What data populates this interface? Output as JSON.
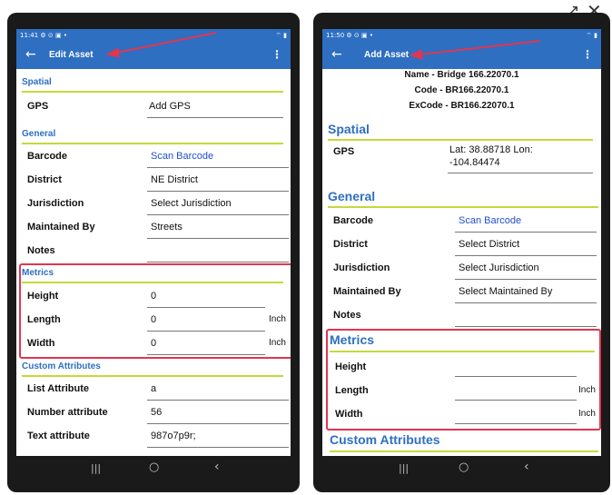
{
  "top_icons": {
    "external": "↗",
    "close": "✕"
  },
  "left": {
    "status_time": "11:41 ⚙ ⊙ ▣ •",
    "status_right": "⌔ ▮",
    "title": "Edit Asset",
    "back": "←",
    "menu": "⋮",
    "spatial_title": "Spatial",
    "gps_label": "GPS",
    "gps_value": "Add GPS",
    "general_title": "General",
    "barcode_label": "Barcode",
    "barcode_value": "Scan Barcode",
    "district_label": "District",
    "district_value": "NE District",
    "jurisdiction_label": "Jurisdiction",
    "jurisdiction_value": "Select Jurisdiction",
    "maintained_label": "Maintained By",
    "maintained_value": "Streets",
    "notes_label": "Notes",
    "notes_value": "",
    "metrics_title": "Metrics",
    "height_label": "Height",
    "height_value": "0",
    "length_label": "Length",
    "length_value": "0",
    "length_unit": "Inch",
    "width_label": "Width",
    "width_value": "0",
    "width_unit": "Inch",
    "custom_title": "Custom Attributes",
    "list_label": "List Attribute",
    "list_value": "a",
    "number_label": "Number attribute",
    "number_value": "56",
    "text_label": "Text attribute",
    "text_value": "987o7p9r;"
  },
  "right": {
    "status_time": "11:50 ⚙ ⊙ ▣ •",
    "status_right": "⌔ ▮",
    "title": "Add Asset",
    "back": "←",
    "menu": "⋮",
    "name_line": "Name - Bridge 166.22070.1",
    "code_line": "Code - BR166.22070.1",
    "excode_line": "ExCode - BR166.22070.1",
    "spatial_title": "Spatial",
    "gps_label": "GPS",
    "gps_value_line1": "Lat: 38.88718  Lon:",
    "gps_value_line2": "-104.84474",
    "general_title": "General",
    "barcode_label": "Barcode",
    "barcode_value": "Scan Barcode",
    "district_label": "District",
    "district_value": "Select District",
    "jurisdiction_label": "Jurisdiction",
    "jurisdiction_value": "Select Jurisdiction",
    "maintained_label": "Maintained By",
    "maintained_value": "Select Maintained By",
    "notes_label": "Notes",
    "metrics_title": "Metrics",
    "height_label": "Height",
    "length_label": "Length",
    "length_unit": "Inch",
    "width_label": "Width",
    "width_unit": "Inch",
    "custom_title": "Custom Attributes"
  },
  "nav": {
    "recent": "|||",
    "home": "○",
    "back": "‹"
  },
  "colors": {
    "appbar": "#2e6fc2",
    "accent_rule": "#c6d93b",
    "highlight": "#e0364f",
    "link": "#1f4fd1"
  }
}
